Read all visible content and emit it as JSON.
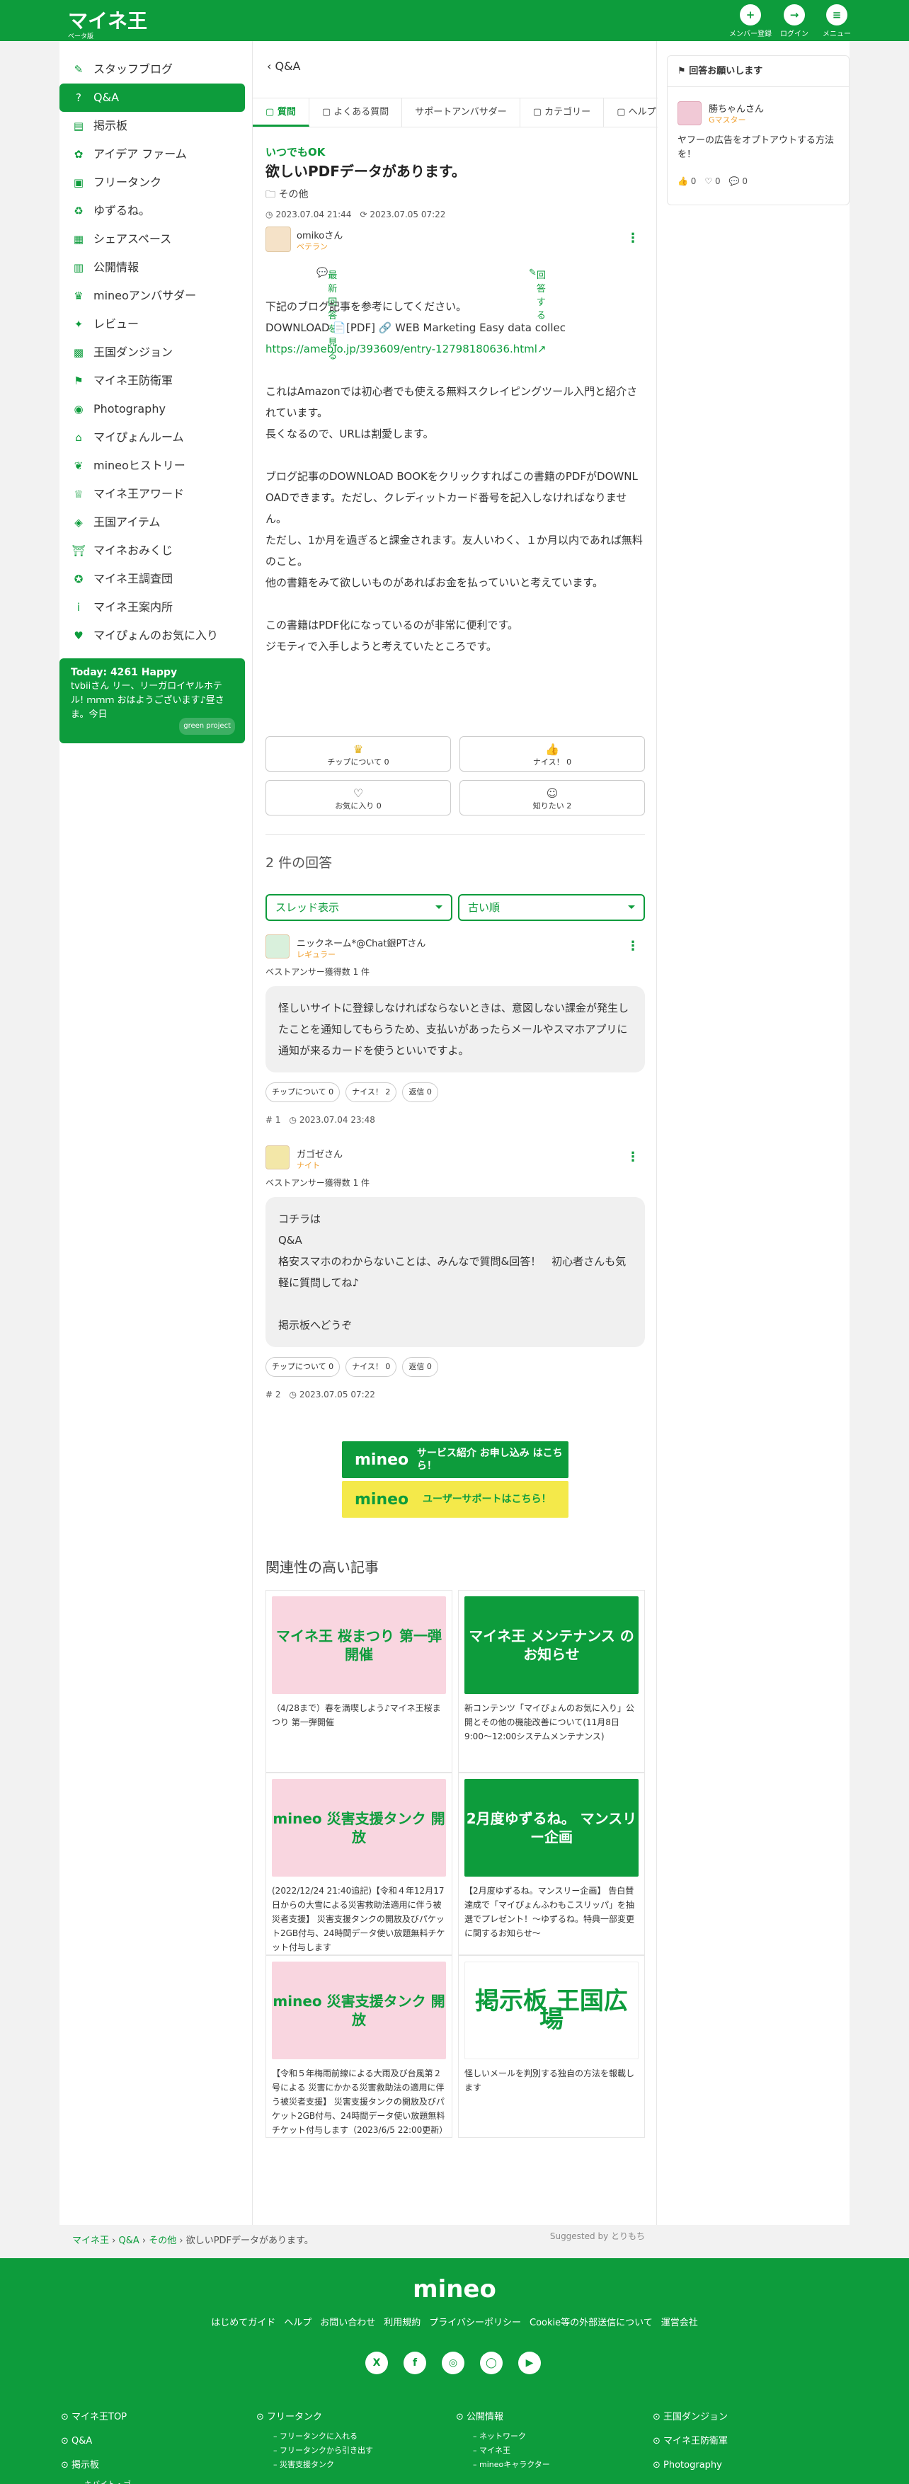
{
  "header": {
    "logo": "マイネ王",
    "logo_sub": "ベータ版",
    "buttons": [
      {
        "label": "メンバー登録",
        "icon": "person-plus-icon",
        "glyph": "+"
      },
      {
        "label": "ログイン",
        "icon": "login-icon",
        "glyph": "→"
      },
      {
        "label": "メニュー",
        "icon": "menu-icon",
        "glyph": "≡"
      }
    ]
  },
  "sidebar": {
    "items": [
      {
        "label": "スタッフブログ",
        "glyph": "✎"
      },
      {
        "label": "Q&A",
        "glyph": "?"
      },
      {
        "label": "掲示板",
        "glyph": "▤"
      },
      {
        "label": "アイデア ファーム",
        "glyph": "✿"
      },
      {
        "label": "フリータンク",
        "glyph": "▣"
      },
      {
        "label": "ゆずるね。",
        "glyph": "♻"
      },
      {
        "label": "シェアスペース",
        "glyph": "▦"
      },
      {
        "label": "公開情報",
        "glyph": "▥"
      },
      {
        "label": "mineoアンバサダー",
        "glyph": "♛"
      },
      {
        "label": "レビュー",
        "glyph": "✦"
      },
      {
        "label": "王国ダンジョン",
        "glyph": "▩"
      },
      {
        "label": "マイネ王防衛軍",
        "glyph": "⚑"
      },
      {
        "label": "Photography",
        "glyph": "◉"
      },
      {
        "label": "マイぴょんルーム",
        "glyph": "⌂"
      },
      {
        "label": "mineoヒストリー",
        "glyph": "❦"
      },
      {
        "label": "マイネ王アワード",
        "glyph": "♕"
      },
      {
        "label": "王国アイテム",
        "glyph": "◈"
      },
      {
        "label": "マイネおみくじ",
        "glyph": "⛩"
      },
      {
        "label": "マイネ王調査団",
        "glyph": "✪"
      },
      {
        "label": "マイネ王案内所",
        "glyph": "i"
      },
      {
        "label": "マイぴょんのお気に入り",
        "glyph": "♥"
      }
    ],
    "today": {
      "title": "Today: 4261 Happy",
      "text": "tvbiiさん リー、リーガロイヤルホテル! ｍｍｍ おはようございます♪昼さま。今日",
      "badge": "green project"
    }
  },
  "back": "Q&A",
  "tabs": [
    {
      "label": "質問",
      "icon": "question-tab-icon"
    },
    {
      "label": "よくある質問",
      "icon": "faq-tab-icon"
    },
    {
      "label": "サポートアンバサダー",
      "icon": ""
    },
    {
      "label": "カテゴリー",
      "icon": "folder-icon"
    },
    {
      "label": "ヘルプ",
      "icon": "help-icon"
    }
  ],
  "question": {
    "tagline": "いつでもOK",
    "title": "欲しいPDFデータがあります。",
    "category": "その他",
    "posted": "2023.07.04 21:44",
    "updated": "2023.07.05 07:22",
    "author": "omikoさん",
    "rank": "ベテラン",
    "link_latest": "最新回答を見る",
    "link_answer": "回答する",
    "body": [
      "下記のブログ記事を参考にしてください。",
      "DOWNLOAD 📄[PDF] 🔗 WEB Marketing Easy data collec",
      "https://ameblo.jp/393609/entry-12798180636.html↗",
      "",
      "これはAmazonでは初心者でも使える無料スクレイピングツール入門と紹介されています。",
      "長くなるので、URLは割愛します。",
      "",
      "ブログ記事のDOWNLOAD BOOKをクリックすればこの書籍のPDFがDOWNLOADできます。ただし、クレディットカード番号を記入しなければなりません。",
      "ただし、1か月を過ぎると課金されます。友人いわく、１か月以内であれば無料のこと。",
      "他の書籍をみて欲しいものがあればお金を払っていいと考えています。",
      "",
      "この書籍はPDF化になっているのが非常に便利です。",
      "ジモティで入手しようと考えていたところです。"
    ],
    "reactions": [
      {
        "label": "チップについて 0",
        "glyph": "♛",
        "gold": true
      },
      {
        "label": "ナイス！ 0",
        "glyph": "👍"
      },
      {
        "label": "お気に入り 0",
        "glyph": "♡"
      },
      {
        "label": "知りたい 2",
        "glyph": "☺"
      }
    ]
  },
  "answers_count": "2 件の回答",
  "sort": {
    "view": "スレッド表示",
    "order": "古い順"
  },
  "answers": [
    {
      "author": "ニックネーム*@Chat銀PTさん",
      "rank": "レギュラー",
      "best": "ベストアンサー獲得数 1 件",
      "body": [
        "怪しいサイトに登録しなければならないときは、意図しない課金が発生したことを通知してもらうため、支払いがあったらメールやスマホアプリに通知が来るカードを使うといいですよ。"
      ],
      "buttons": [
        "チップについて 0",
        "ナイス！ 2",
        "返信 0"
      ],
      "num": "1",
      "date": "2023.07.04 23:48"
    },
    {
      "author": "ガゴゼさん",
      "rank": "ナイト",
      "best": "ベストアンサー獲得数 1 件",
      "body": [
        "コチラは",
        "Q&A",
        "格安スマホのわからないことは、みんなで質問&回答！　初心者さんも気軽に質問してね♪",
        "",
        "掲示板へどうぞ"
      ],
      "buttons": [
        "チップについて 0",
        "ナイス！ 0",
        "返信 0"
      ],
      "num": "2",
      "date": "2023.07.05 07:22"
    }
  ],
  "banners": [
    {
      "logo": "mineo",
      "text": "サービス紹介 お申し込み はこちら！"
    },
    {
      "logo": "mineo",
      "text": "ユーザーサポートはこちら！"
    }
  ],
  "related": {
    "heading": "関連性の高い記事",
    "cards": [
      {
        "thumb": "マイネ王 桜まつり 第一弾開催",
        "style": "t-pink",
        "text": "（4/28まで）春を満喫しよう♪マイネ王桜まつり 第一弾開催"
      },
      {
        "thumb": "マイネ王 メンテナンス のお知らせ",
        "style": "t-green",
        "text": "新コンテンツ「マイぴょんのお気に入り」公開とその他の機能改善について(11月8日9:00〜12:00システムメンテナンス)"
      },
      {
        "thumb": "mineo 災害支援タンク 開放",
        "style": "t-pink",
        "text": "(2022/12/24 21:40追記)【令和４年12月17日からの大雪による災害救助法適用に伴う被災者支援】 災害支援タンクの開放及びパケット2GB付与、24時間データ使い放題無料チケット付与します"
      },
      {
        "thumb": "2月度ゆずるね。 マンスリー企画",
        "style": "t-green",
        "text": "【2月度ゆずるね。マンスリー企画】 告白賛達成で「マイぴょんふわもこスリッパ」を抽選でプレゼント！〜ゆずるね。特典一部変更に関するお知らせ〜"
      },
      {
        "thumb": "mineo 災害支援タンク 開放",
        "style": "t-pink",
        "text": "【令和５年梅雨前線による大雨及び台風第２号による 災害にかかる災害救助法の適用に伴う被災者支援】 災害支援タンクの開放及びパケット2GB付与、24時間データ使い放題無料チケット付与します（2023/6/5 22:00更新）"
      },
      {
        "thumb": "掲示板 王国広場",
        "style": "t-white",
        "text": "怪しいメールを判別する独自の方法を報載します"
      }
    ],
    "suggested": "Suggested by とりもち"
  },
  "right": {
    "heading": "回答お願いします",
    "user": "勝ちゃんさん",
    "rank": "Gマスター",
    "text": "ヤフーの広告をオプトアウトする方法を！",
    "counts": "👍 0　♡ 0　💬 0"
  },
  "breadcrumb": [
    "マイネ王",
    "Q&A",
    "その他",
    "欲しいPDFデータがあります。"
  ],
  "footer": {
    "logo": "mineo",
    "links": [
      "はじめてガイド",
      "ヘルプ",
      "お問い合わせ",
      "利用規約",
      "プライバシーポリシー",
      "Cookie等の外部送信について",
      "運営会社"
    ],
    "social": [
      "X",
      "f",
      "◎",
      "◯",
      "▶"
    ],
    "cols": [
      {
        "title": "マイネ王TOP",
        "items": []
      },
      {
        "title": "Q&A",
        "items": []
      },
      {
        "title": "掲示板",
        "items": [
          "キバイト・ゴ"
        ]
      }
    ],
    "cols2": [
      {
        "title": "フリータンク",
        "items": [
          "フリータンクに入れる",
          "フリータンクから引き出す",
          "災害支援タンク"
        ]
      }
    ],
    "cols3": [
      {
        "title": "公開情報",
        "items": [
          "ネットワーク",
          "マイネ王",
          "mineoキャラクター"
        ]
      }
    ],
    "cols4": [
      {
        "title": "王国ダンジョン",
        "items": []
      },
      {
        "title": "マイネ王防衛軍",
        "items": []
      },
      {
        "title": "Photography",
        "items": []
      }
    ]
  }
}
